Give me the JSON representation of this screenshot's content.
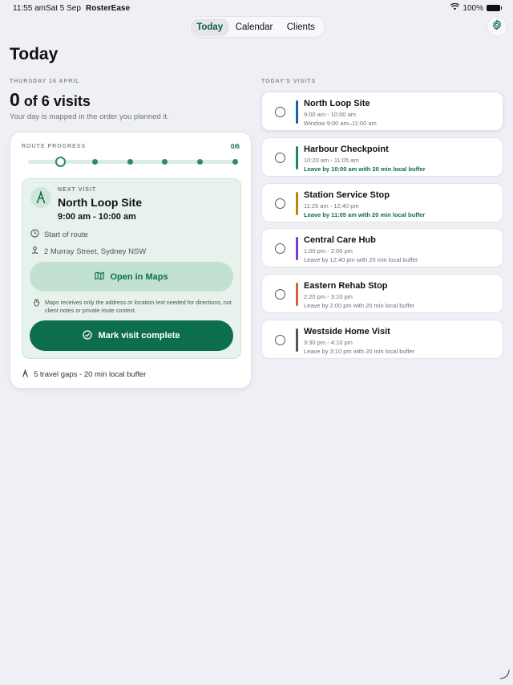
{
  "status_bar": {
    "time": "11:55 am",
    "date": "Sat 5 Sep",
    "app": "RosterEase",
    "battery": "100%"
  },
  "tabs": [
    {
      "label": "Today",
      "active": true
    },
    {
      "label": "Calendar",
      "active": false
    },
    {
      "label": "Clients",
      "active": false
    }
  ],
  "page_title": "Today",
  "summary": {
    "date_label": "THURSDAY 16 APRIL",
    "count": "0",
    "count_suffix": "of 6 visits",
    "subtitle": "Your day is mapped in the order you planned it."
  },
  "route": {
    "label": "ROUTE PROGRESS",
    "count": "0/6",
    "progress": 0,
    "stops": 6,
    "current_index": 0
  },
  "next_visit": {
    "label": "NEXT VISIT",
    "name": "North Loop Site",
    "time": "9:00 am - 10:00 am",
    "start": "Start of route",
    "address": "2 Murray Street, Sydney NSW",
    "maps_label": "Open in Maps",
    "privacy_note": "Maps receives only the address or location text needed for directions, not client notes or private route context.",
    "complete_label": "Mark visit complete"
  },
  "travel_gaps": "5 travel gaps - 20 min local buffer",
  "visits_label": "TODAY'S VISITS",
  "visits": [
    {
      "name": "North Loop Site",
      "time": "9:00 am - 10:00 am",
      "note": "Window 9:00 am–11:00 am",
      "note_style": "gray",
      "color": "#1e5fa8"
    },
    {
      "name": "Harbour Checkpoint",
      "time": "10:20 am - 11:05 am",
      "note": "Leave by 10:00 am with 20 min local buffer",
      "note_style": "green",
      "color": "#1e8a58"
    },
    {
      "name": "Station Service Stop",
      "time": "11:25 am - 12:40 pm",
      "note": "Leave by 11:05 am with 20 min local buffer",
      "note_style": "green",
      "color": "#b8860b"
    },
    {
      "name": "Central Care Hub",
      "time": "1:00 pm - 2:00 pm",
      "note": "Leave by 12:40 pm with 20 min local buffer",
      "note_style": "gray",
      "color": "#7b3fc4"
    },
    {
      "name": "Eastern Rehab Stop",
      "time": "2:20 pm - 3:10 pm",
      "note": "Leave by 2:00 pm with 20 min local buffer",
      "note_style": "gray",
      "color": "#d2603a"
    },
    {
      "name": "Westside Home Visit",
      "time": "3:30 pm - 4:10 pm",
      "note": "Leave by 3:10 pm with 20 min local buffer",
      "note_style": "gray",
      "color": "#4a5a56"
    }
  ]
}
